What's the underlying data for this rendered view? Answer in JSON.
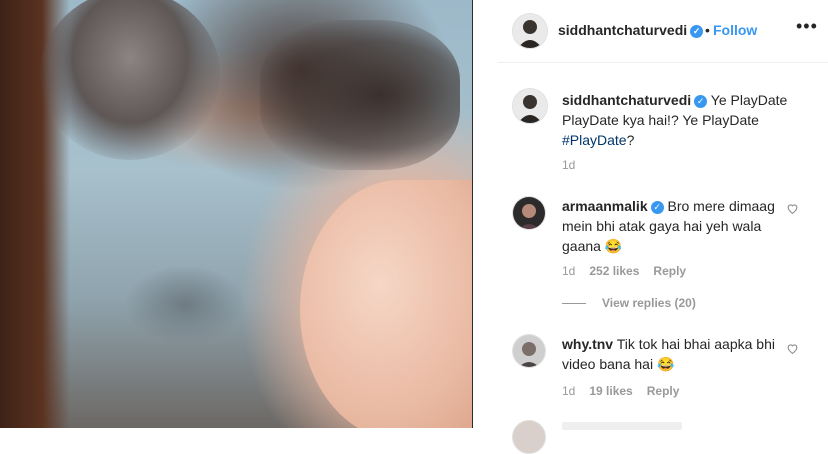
{
  "post": {
    "author": "siddhantchaturvedi",
    "dot": "•",
    "follow_label": "Follow",
    "more_label": "•••",
    "verified_glyph": "✓"
  },
  "caption": {
    "author": "siddhantchaturvedi",
    "text_before": "Ye PlayDate PlayDate kya hai!? Ye PlayDate ",
    "hashtag": "#PlayDate",
    "text_after": "?",
    "time": "1d"
  },
  "comments": [
    {
      "author": "armaanmalik",
      "verified": true,
      "text": "Bro mere dimaag mein bhi atak gaya hai yeh wala gaana 😂",
      "time": "1d",
      "likes": "252 likes",
      "reply": "Reply",
      "view_replies": "View replies (20)"
    },
    {
      "author": "why.tnv",
      "verified": false,
      "text": "Tik tok hai bhai aapka bhi video bana hai 😂",
      "time": "1d",
      "likes": "19 likes",
      "reply": "Reply"
    }
  ],
  "colors": {
    "accent": "#3897f0",
    "hashtag": "#003569",
    "muted": "#999999"
  },
  "icons": {
    "like": "heart-icon",
    "verified": "verified-badge-icon",
    "more": "more-options-icon"
  }
}
